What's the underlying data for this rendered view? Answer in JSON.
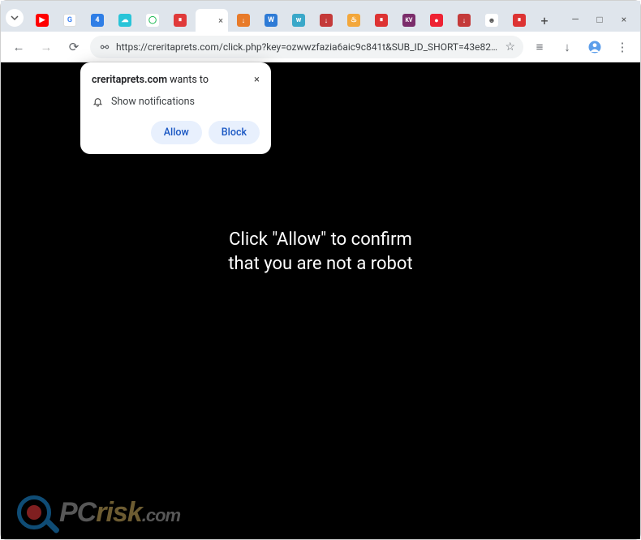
{
  "window": {
    "minimize": "—",
    "maximize": "□",
    "close": "×"
  },
  "tabs": {
    "new_tab": "+",
    "active_close": "×"
  },
  "toolbar": {
    "back": "←",
    "forward": "→",
    "reload": "⟳",
    "url": "https://creritaprets.com/click.php?key=ozwwzfazia6aic9c841t&SUB_ID_SHORT=43e82d5b3d16ae0f79412bdd71bb...",
    "star": "☆",
    "reading": "≡",
    "download": "↓",
    "profile": "👤",
    "menu": "⋮"
  },
  "permission": {
    "site": "creritaprets.com",
    "wants": " wants to",
    "close": "×",
    "notif": "Show notifications",
    "allow": "Allow",
    "block": "Block"
  },
  "page": {
    "line1": "Click \"Allow\" to confirm",
    "line2": "that you are not a robot"
  },
  "watermark": {
    "pc": "PC",
    "risk": "risk",
    "dot": ".com"
  }
}
